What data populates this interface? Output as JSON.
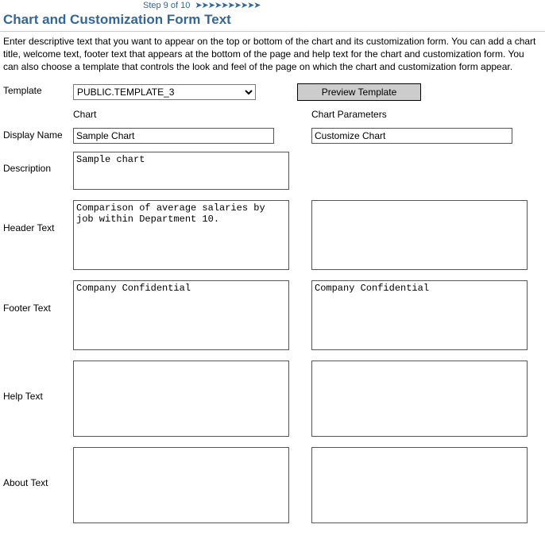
{
  "step": {
    "label": "Step 9 of 10"
  },
  "page": {
    "title": "Chart and Customization Form Text",
    "intro": "Enter descriptive text that you want to appear on the top or bottom of the chart and its customization form. You can add a chart title, welcome text, footer text that appears at the bottom of the page and help text for the chart and customization form. You can also choose a template that controls the look and feel of the page on which the chart and customization form appear."
  },
  "labels": {
    "template": "Template",
    "chart_col": "Chart",
    "params_col": "Chart Parameters",
    "display_name": "Display Name",
    "description": "Description",
    "header": "Header Text",
    "footer": "Footer Text",
    "help": "Help Text",
    "about": "About Text",
    "preview_btn": "Preview Template"
  },
  "form": {
    "template_value": "PUBLIC.TEMPLATE_3",
    "chart": {
      "display_name": "Sample Chart",
      "description": "Sample chart",
      "header": "Comparison of average salaries by job within Department 10.",
      "footer": "Company Confidential",
      "help": "",
      "about": ""
    },
    "params": {
      "display_name": "Customize Chart",
      "header": "",
      "footer": "Company Confidential",
      "help": "",
      "about": ""
    }
  }
}
